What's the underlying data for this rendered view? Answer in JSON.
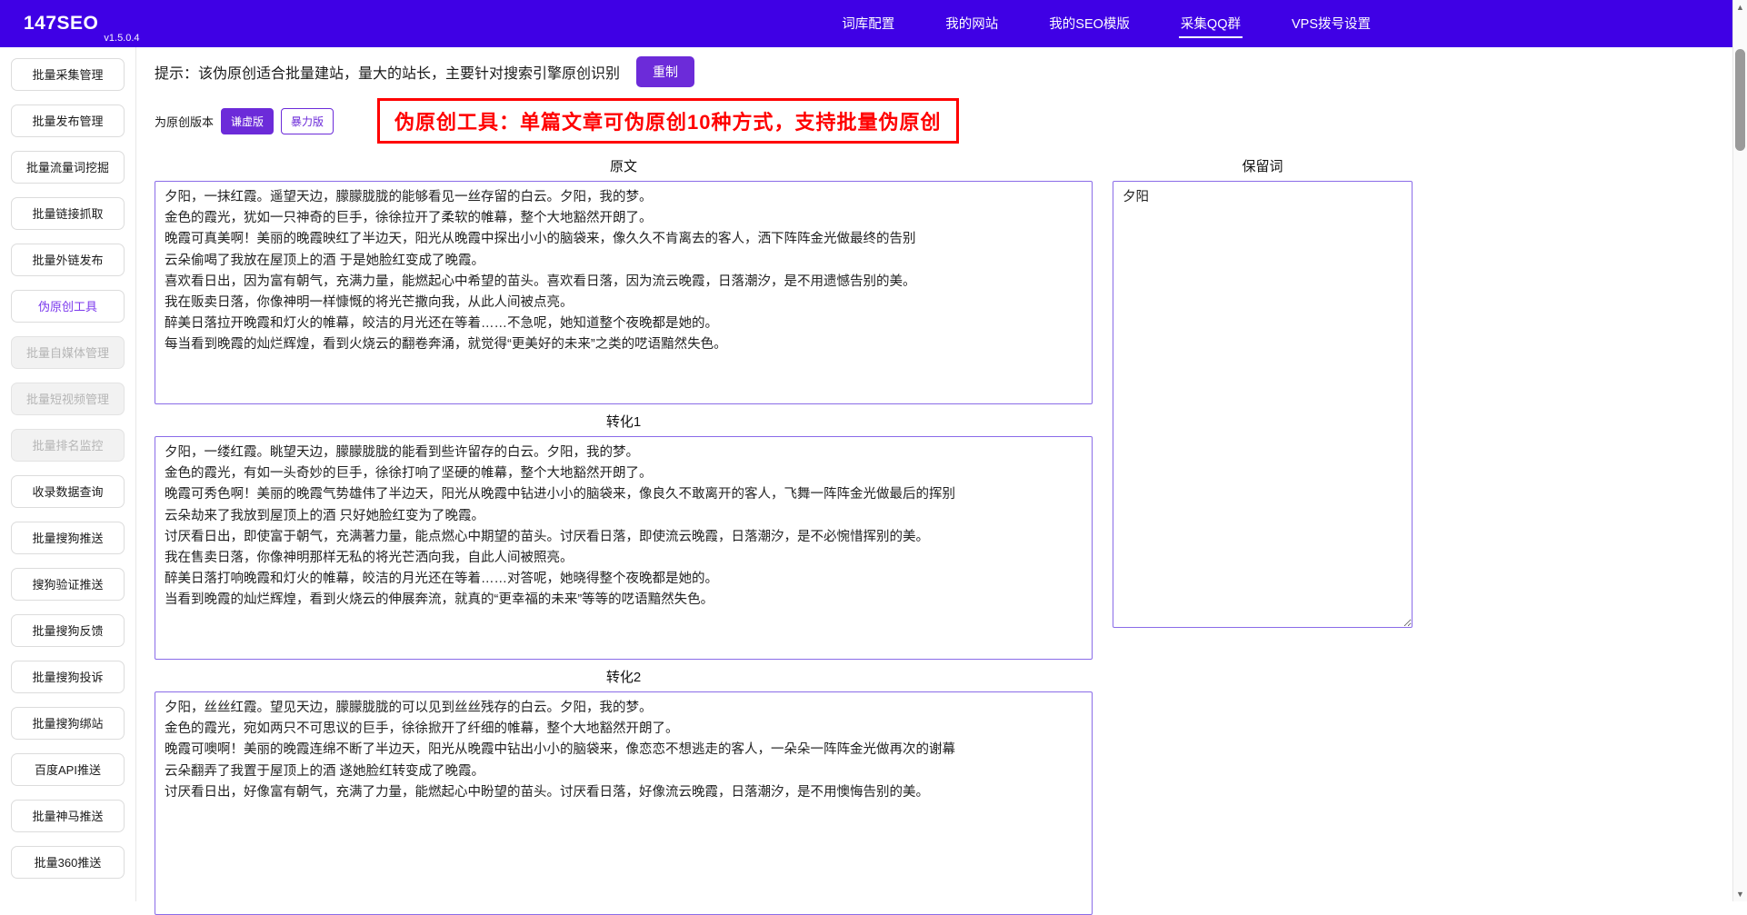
{
  "colors": {
    "header_bg": "#3f00e5",
    "accent": "#6c2bd9",
    "banner_red": "#ff0000",
    "textarea_border": "#8a6ce8"
  },
  "header": {
    "brand": "147SEO",
    "version": "v1.5.0.4",
    "nav": [
      {
        "label": "词库配置"
      },
      {
        "label": "我的网站"
      },
      {
        "label": "我的SEO模版"
      },
      {
        "label": "采集QQ群"
      },
      {
        "label": "VPS拨号设置"
      }
    ]
  },
  "sidebar": {
    "items": [
      {
        "label": "批量采集管理",
        "state": "normal"
      },
      {
        "label": "批量发布管理",
        "state": "normal"
      },
      {
        "label": "批量流量词挖掘",
        "state": "normal"
      },
      {
        "label": "批量链接抓取",
        "state": "normal"
      },
      {
        "label": "批量外链发布",
        "state": "normal"
      },
      {
        "label": "伪原创工具",
        "state": "active"
      },
      {
        "label": "批量自媒体管理",
        "state": "disabled"
      },
      {
        "label": "批量短视频管理",
        "state": "disabled"
      },
      {
        "label": "批量排名监控",
        "state": "disabled"
      },
      {
        "label": "收录数据查询",
        "state": "normal"
      },
      {
        "label": "批量搜狗推送",
        "state": "normal"
      },
      {
        "label": "搜狗验证推送",
        "state": "normal"
      },
      {
        "label": "批量搜狗反馈",
        "state": "normal"
      },
      {
        "label": "批量搜狗投诉",
        "state": "normal"
      },
      {
        "label": "批量搜狗绑站",
        "state": "normal"
      },
      {
        "label": "百度API推送",
        "state": "normal"
      },
      {
        "label": "批量神马推送",
        "state": "normal"
      },
      {
        "label": "批量360推送",
        "state": "normal"
      }
    ]
  },
  "main": {
    "tip": "提示：该伪原创适合批量建站，量大的站长，主要针对搜索引擎原创识别",
    "rebuild_button": "重制",
    "version_label": "为原创版本",
    "mode_buttons": [
      {
        "label": "谦虚版",
        "active": true
      },
      {
        "label": "暴力版",
        "active": false
      }
    ],
    "banner": "伪原创工具：单篇文章可伪原创10种方式，支持批量伪原创",
    "original": {
      "label": "原文",
      "text": "夕阳，一抹红霞。遥望天边，朦朦胧胧的能够看见一丝存留的白云。夕阳，我的梦。\n金色的霞光，犹如一只神奇的巨手，徐徐拉开了柔软的帷幕，整个大地豁然开朗了。\n晚霞可真美啊！美丽的晚霞映红了半边天，阳光从晚霞中探出小小的脑袋来，像久久不肯离去的客人，洒下阵阵金光做最终的告别\n云朵偷喝了我放在屋顶上的酒 于是她脸红变成了晚霞。\n喜欢看日出，因为富有朝气，充满力量，能燃起心中希望的苗头。喜欢看日落，因为流云晚霞，日落潮汐，是不用遗憾告别的美。\n我在贩卖日落，你像神明一样慷慨的将光芒撒向我，从此人间被点亮。\n醉美日落拉开晚霞和灯火的帷幕，皎洁的月光还在等着……不急呢，她知道整个夜晚都是她的。\n每当看到晚霞的灿烂辉煌，看到火烧云的翻卷奔涌，就觉得“更美好的未来”之类的呓语黯然失色。"
    },
    "keep_words": {
      "label": "保留词",
      "text": "夕阳"
    },
    "transform1": {
      "label": "转化1",
      "text": "夕阳，一缕红霞。眺望天边，朦朦胧胧的能看到些许留存的白云。夕阳，我的梦。\n金色的霞光，有如一头奇妙的巨手，徐徐打响了坚硬的帷幕，整个大地豁然开朗了。\n晚霞可秀色啊！美丽的晚霞气势雄伟了半边天，阳光从晚霞中钻进小小的脑袋来，像良久不敢离开的客人，飞舞一阵阵金光做最后的挥别\n云朵劫来了我放到屋顶上的酒 只好她脸红变为了晚霞。\n讨厌看日出，即使富于朝气，充满著力量，能点燃心中期望的苗头。讨厌看日落，即使流云晚霞，日落潮汐，是不必惋惜挥别的美。\n我在售卖日落，你像神明那样无私的将光芒洒向我，自此人间被照亮。\n醉美日落打响晚霞和灯火的帷幕，皎洁的月光还在等着……对答呢，她晓得整个夜晚都是她的。\n当看到晚霞的灿烂辉煌，看到火烧云的伸展奔流，就真的“更幸福的未来”等等的呓语黯然失色。"
    },
    "transform2": {
      "label": "转化2",
      "text": "夕阳，丝丝红霞。望见天边，朦朦胧胧的可以见到丝丝残存的白云。夕阳，我的梦。\n金色的霞光，宛如两只不可思议的巨手，徐徐掀开了纤细的帷幕，整个大地豁然开朗了。\n晚霞可噢啊！美丽的晚霞连绵不断了半边天，阳光从晚霞中钻出小小的脑袋来，像恋恋不想逃走的客人，一朵朵一阵阵金光做再次的谢幕\n云朵翻弄了我置于屋顶上的酒 遂她脸红转变成了晚霞。\n讨厌看日出，好像富有朝气，充满了力量，能燃起心中盼望的苗头。讨厌看日落，好像流云晚霞，日落潮汐，是不用懊悔告别的美。"
    }
  },
  "scrollbar": {
    "up_icon": "▲",
    "down_icon": "▼"
  }
}
